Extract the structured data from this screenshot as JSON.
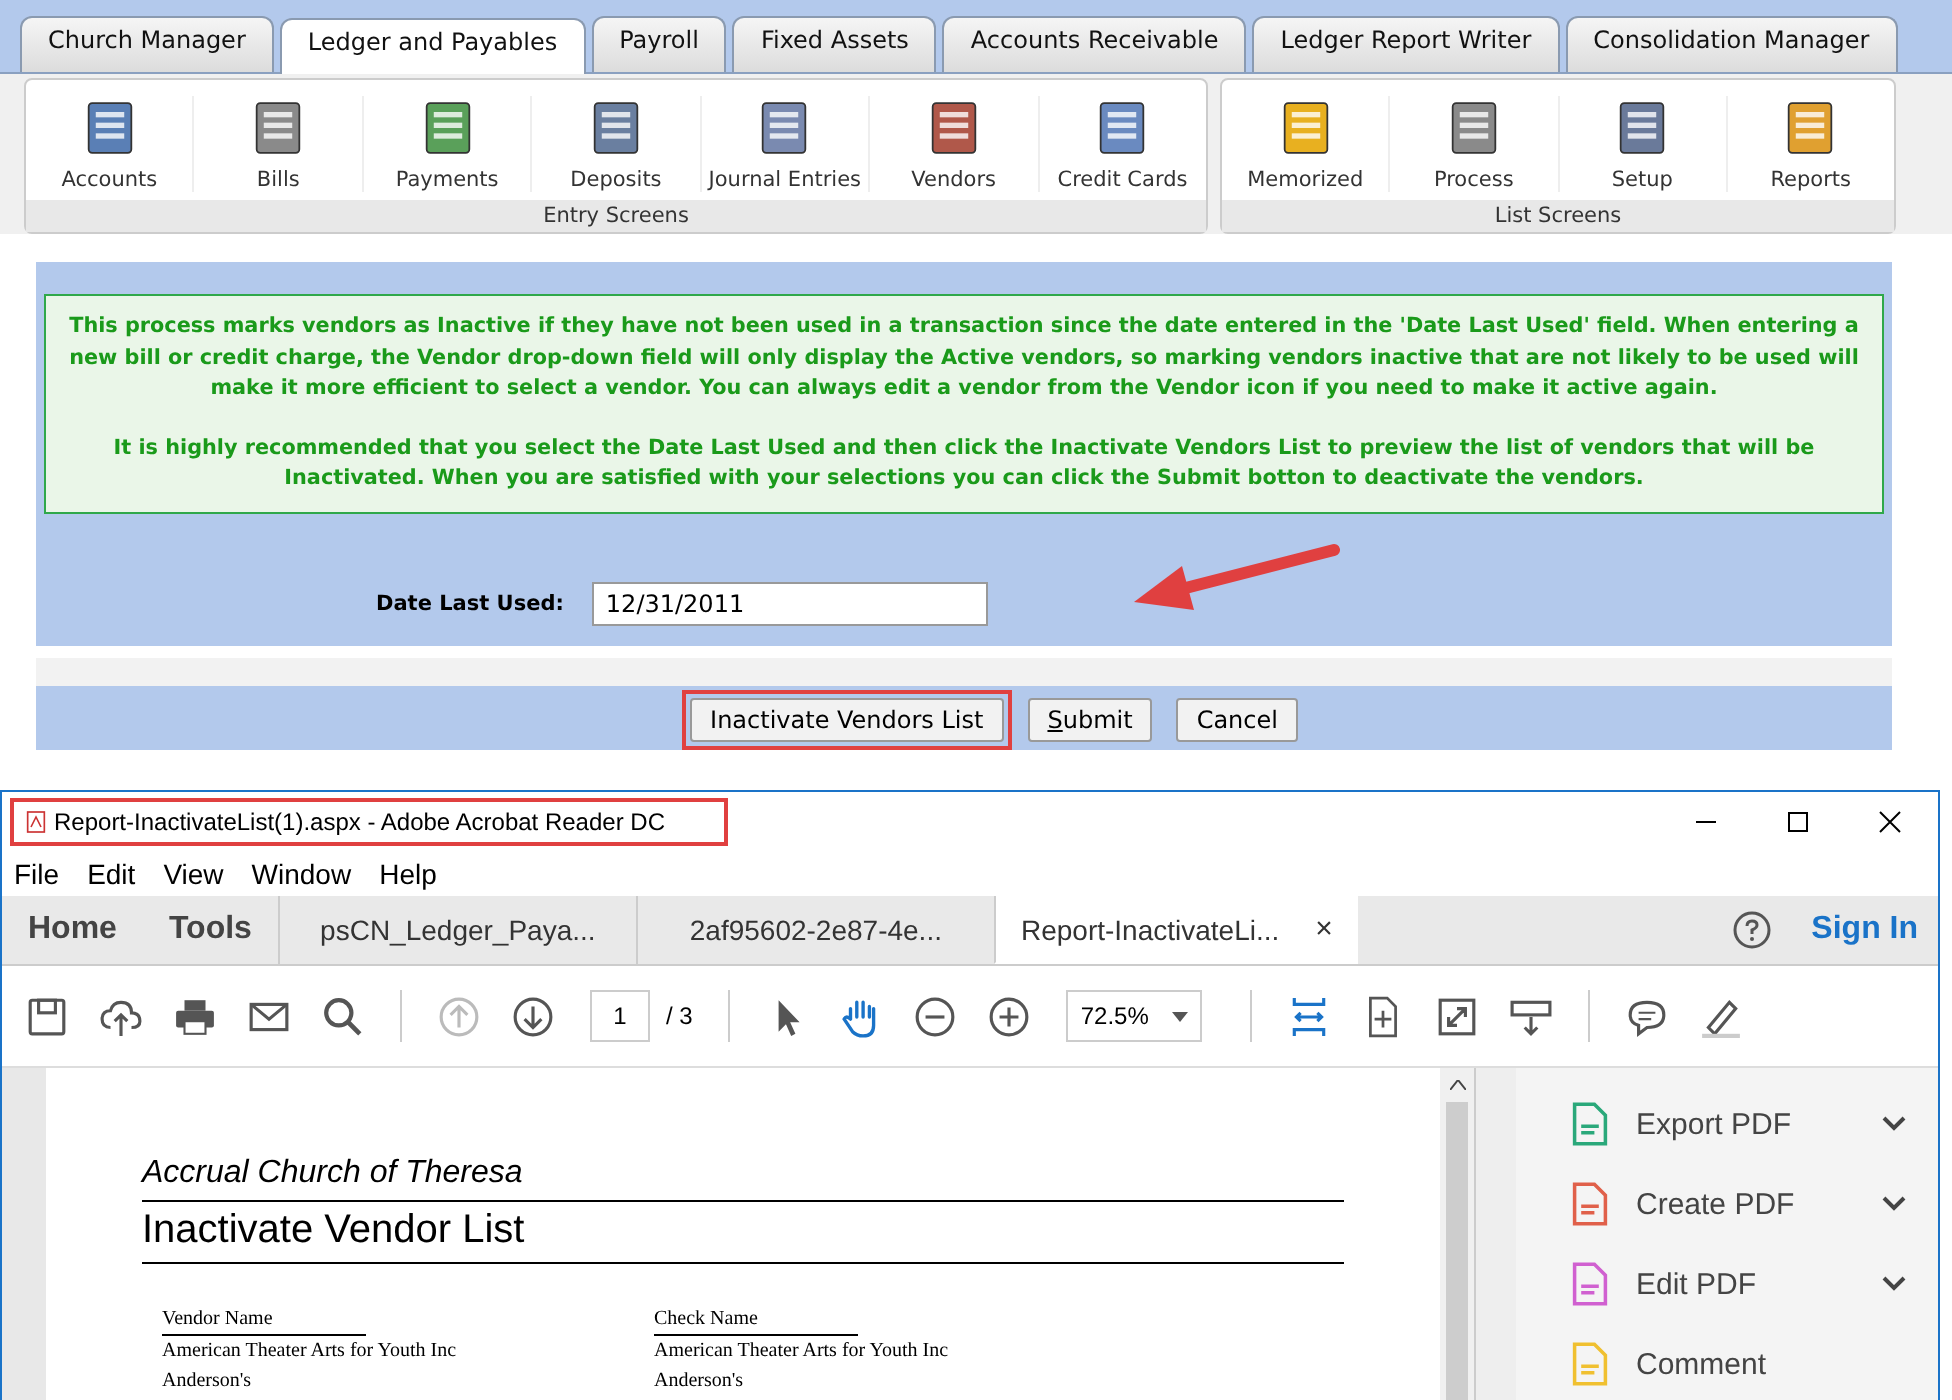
{
  "app_tabs": [
    {
      "label": "Church Manager",
      "selected": false
    },
    {
      "label": "Ledger and Payables",
      "selected": true
    },
    {
      "label": "Payroll",
      "selected": false
    },
    {
      "label": "Fixed Assets",
      "selected": false
    },
    {
      "label": "Accounts Receivable",
      "selected": false
    },
    {
      "label": "Ledger Report Writer",
      "selected": false
    },
    {
      "label": "Consolidation Manager",
      "selected": false
    }
  ],
  "toolbar_groups": [
    {
      "title": "Entry Screens",
      "items": [
        "Accounts",
        "Bills",
        "Payments",
        "Deposits",
        "Journal Entries",
        "Vendors",
        "Credit Cards"
      ]
    },
    {
      "title": "List Screens",
      "items": [
        "Memorized",
        "Process",
        "Setup",
        "Reports"
      ]
    }
  ],
  "info_paragraphs": [
    "This process marks vendors as Inactive if they have not been used in a transaction since the date entered in the 'Date Last Used' field. When entering a new bill or credit charge, the Vendor drop-down field will only display the Active vendors, so marking vendors inactive that are not likely to be used will make it more efficient to select a vendor. You can always edit a vendor from the Vendor icon if you need to make it active again.",
    "It is highly recommended that you select the Date Last Used and then click the Inactivate Vendors List to preview the list of vendors that will be Inactivated. When you are satisfied with your selections you can click the Submit botton to deactivate the vendors."
  ],
  "date_field": {
    "label": "Date Last Used:",
    "value": "12/31/2011"
  },
  "buttons": [
    {
      "label": "Inactivate Vendors List",
      "highlighted": true,
      "underline_first": false
    },
    {
      "label": "Submit",
      "highlighted": false,
      "underline_first": true
    },
    {
      "label": "Cancel",
      "highlighted": false,
      "underline_first": false
    }
  ],
  "reader": {
    "title": "Report-InactivateList(1).aspx - Adobe Acrobat Reader DC",
    "title_highlighted": true,
    "menu": [
      "File",
      "Edit",
      "View",
      "Window",
      "Help"
    ],
    "nav": [
      "Home",
      "Tools"
    ],
    "doc_tabs": [
      {
        "label": "psCN_Ledger_Paya...",
        "selected": false
      },
      {
        "label": "2af95602-2e87-4e...",
        "selected": false
      },
      {
        "label": "Report-InactivateLi...",
        "selected": true
      }
    ],
    "close_tab": "×",
    "sign_in": "Sign In",
    "page_number": "1",
    "page_total": "/ 3",
    "zoom": "72.5%",
    "document": {
      "organization": "Accrual Church of Theresa",
      "title": "Inactivate Vendor List",
      "columns": [
        "Vendor Name",
        "Check Name"
      ],
      "rows": [
        [
          "American Theater Arts for Youth Inc",
          "American Theater Arts for Youth Inc"
        ],
        [
          "Anderson's",
          "Anderson's"
        ]
      ]
    },
    "tools_pane": [
      {
        "label": "Export PDF",
        "expandable": true
      },
      {
        "label": "Create PDF",
        "expandable": true
      },
      {
        "label": "Edit PDF",
        "expandable": true
      },
      {
        "label": "Comment",
        "expandable": false
      }
    ]
  }
}
